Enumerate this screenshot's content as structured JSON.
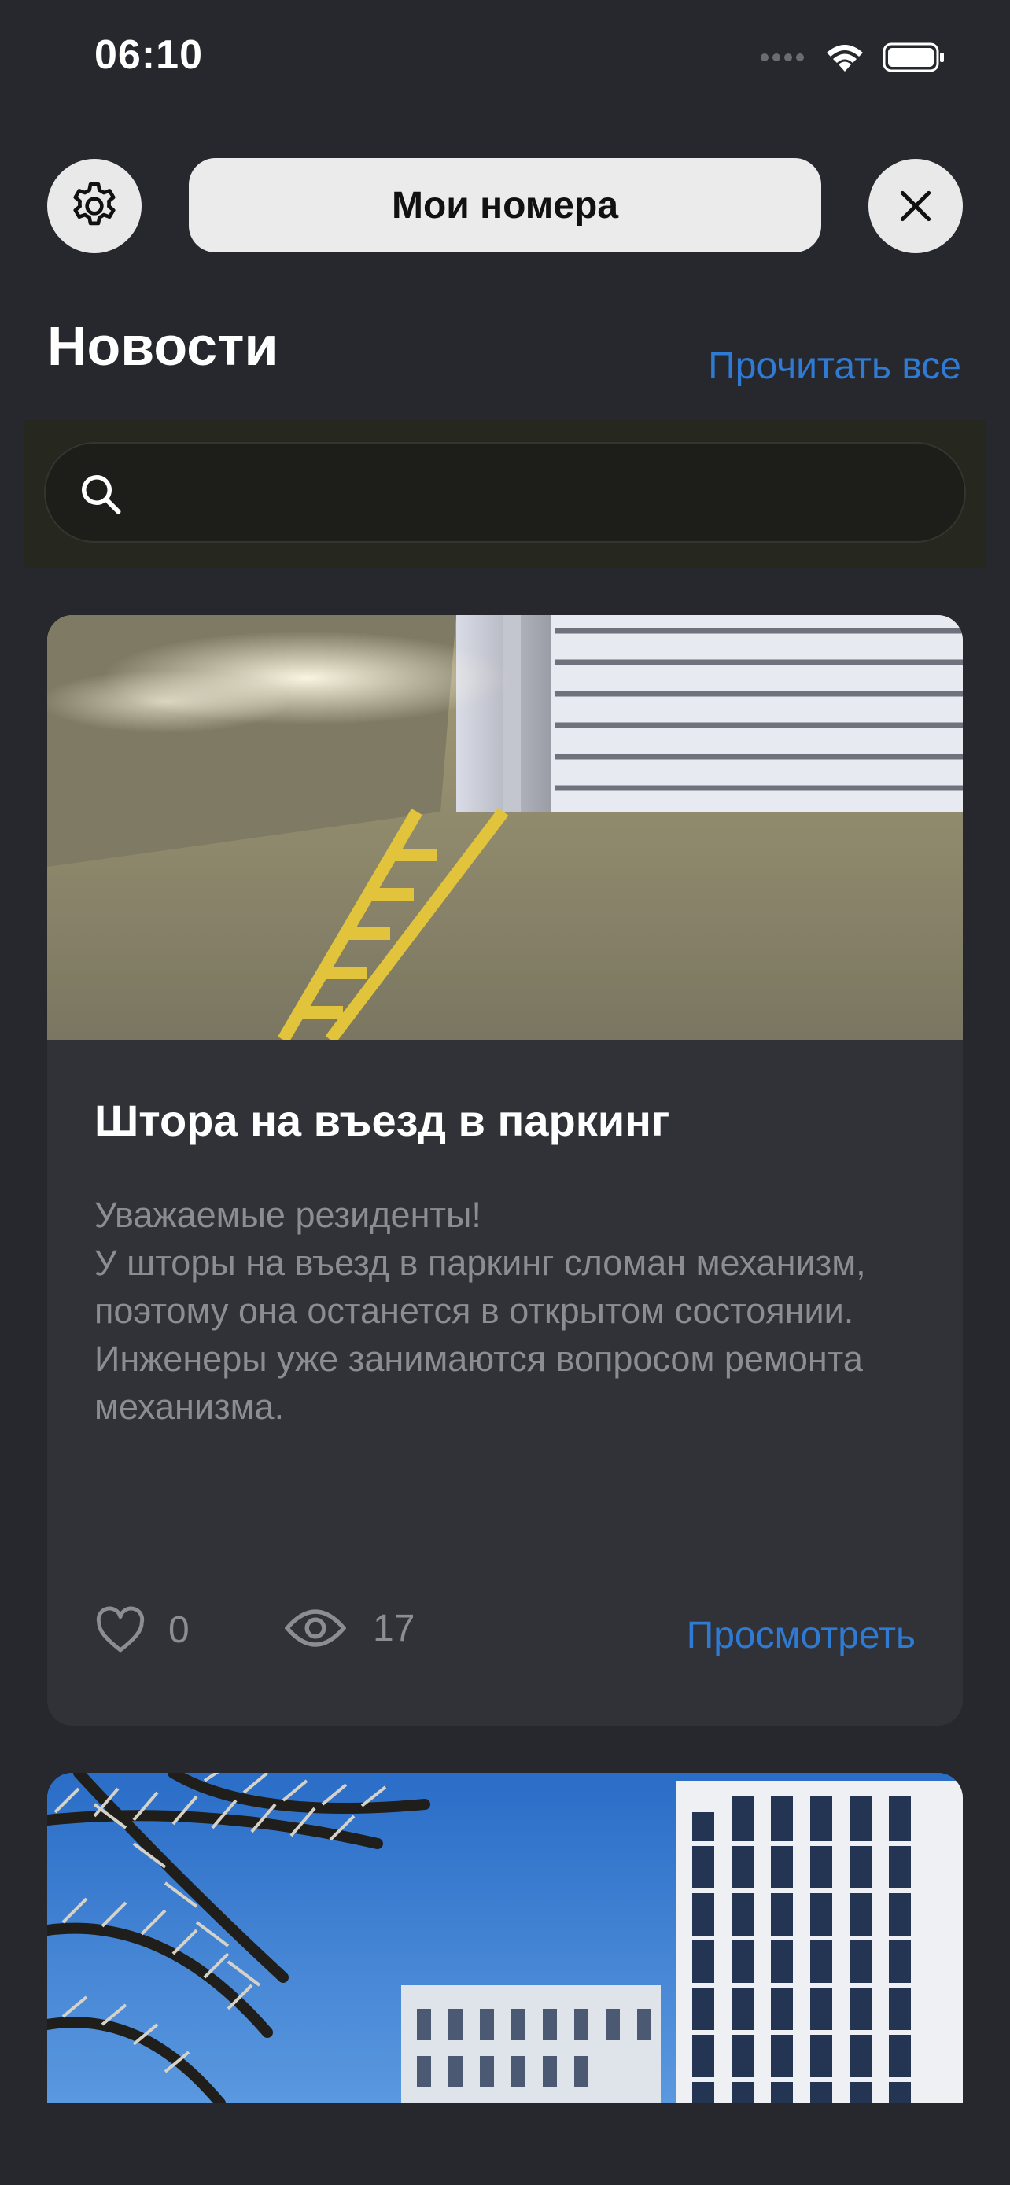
{
  "status_bar": {
    "time": "06:10",
    "icons": [
      "signal-icon",
      "wifi-icon",
      "battery-icon"
    ]
  },
  "top_bar": {
    "settings_icon": "gear-icon",
    "title_button": "Мои номера",
    "close_icon": "close-icon"
  },
  "header": {
    "title": "Новости",
    "read_all": "Прочитать все"
  },
  "search": {
    "placeholder": "",
    "icon": "search-icon"
  },
  "news": [
    {
      "title": "Штора на въезд в паркинг",
      "text": "Уважаемые резиденты!\nУ шторы на въезд в паркинг сломан механизм, поэтому она останется в открытом состоянии. Инженеры уже занимаются вопросом ремонта механизма.",
      "likes": "0",
      "views": "17",
      "view_link": "Просмотреть"
    }
  ],
  "colors": {
    "background": "#27282d",
    "card": "#313237",
    "accent": "#2f7ad3",
    "muted_text": "#8c8d92"
  }
}
